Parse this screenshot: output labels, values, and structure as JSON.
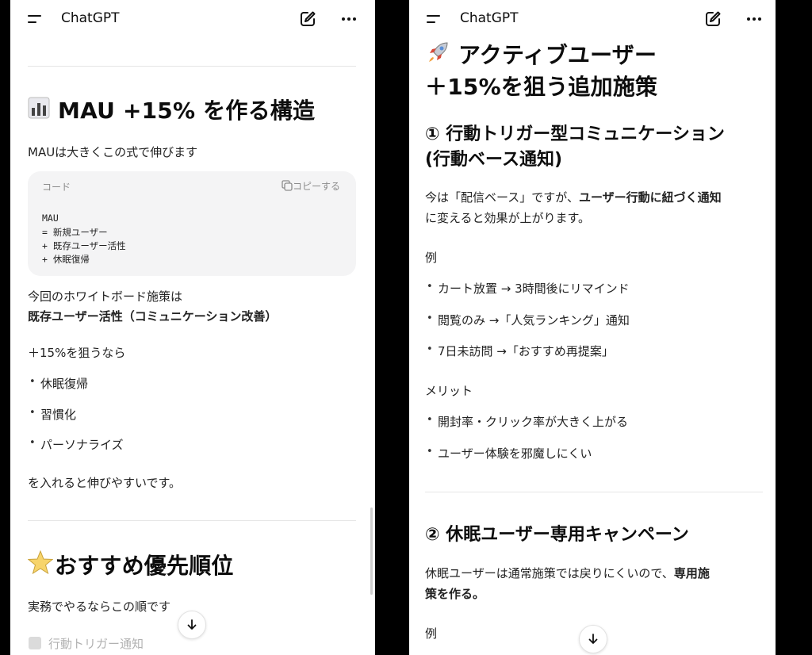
{
  "app_title": "ChatGPT",
  "left": {
    "section1": {
      "icon": "bar-chart-icon",
      "heading": "MAU +15% を作る構造",
      "intro": "MAUは大きくこの式で伸びます",
      "code": {
        "label": "コード",
        "copy": "コピーする",
        "lines": [
          "MAU",
          "=  新規ユーザー",
          "+  既存ユーザー活性",
          "+  休眠復帰"
        ]
      },
      "p1_line1": "今回のホワイトボード施策は",
      "p1_line2": "既存ユーザー活性（コミュニケーション改善）",
      "p2": "＋15%を狙うなら",
      "bullets": [
        "休眠復帰",
        "習慣化",
        "パーソナライズ"
      ],
      "p3": "を入れると伸びやすいです。"
    },
    "section2": {
      "icon": "star-icon",
      "heading": "おすすめ優先順位",
      "intro": "実務でやるならこの順です",
      "faded_item": "行動トリガー通知"
    }
  },
  "right": {
    "section_title": {
      "icon": "rocket-icon",
      "line1": "アクティブユーザー",
      "line2": "＋15%を狙う追加施策"
    },
    "item1": {
      "heading_line1": "① 行動トリガー型コミュニケーション",
      "heading_line2": "(行動ベース通知)",
      "p1_a": "今は「配信ベース」ですが、",
      "p1_b": "ユーザー行動に紐づく通知",
      "p1_c": "に変えると効果が上がります。",
      "example_label": "例",
      "examples": [
        "カート放置 → 3時間後にリマインド",
        "閲覧のみ →「人気ランキング」通知",
        "7日未訪問 →「おすすめ再提案」"
      ],
      "merit_label": "メリット",
      "merits": [
        "開封率・クリック率が大きく上がる",
        "ユーザー体験を邪魔しにくい"
      ]
    },
    "item2": {
      "heading": "② 休眠ユーザー専用キャンペーン",
      "p1_a": "休眠ユーザーは通常施策では戻りにくいので、",
      "p1_b": "専用施",
      "p1_c": "策を作る。",
      "example_label": "例"
    }
  }
}
